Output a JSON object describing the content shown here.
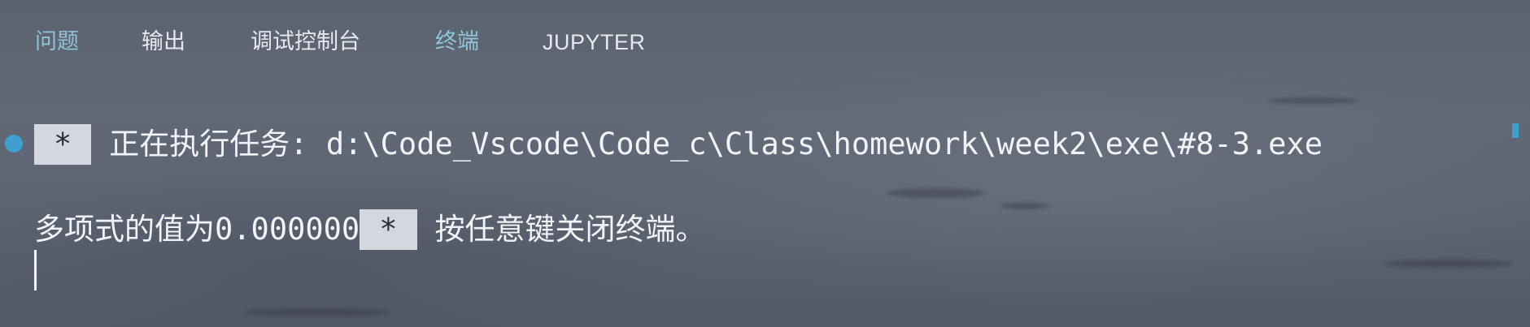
{
  "panel": {
    "tabs": [
      {
        "label": "问题"
      },
      {
        "label": "输出"
      },
      {
        "label": "调试控制台"
      },
      {
        "label": "终端"
      },
      {
        "label": "JUPYTER"
      }
    ]
  },
  "terminal": {
    "task_star": "*",
    "task_text": "正在执行任务: d:\\Code_Vscode\\Code_c\\Class\\homework\\week2\\exe\\#8-3.exe",
    "output_text": "多项式的值为0.000000",
    "close_star": "*",
    "close_text": "按任意键关闭终端。"
  },
  "colors": {
    "accent": "#8fc4d8",
    "indicator": "#3e9fd0"
  }
}
